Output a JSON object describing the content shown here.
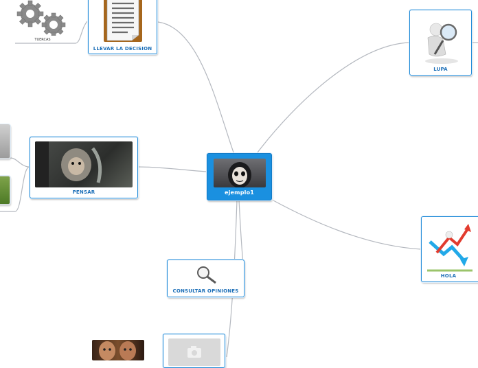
{
  "central": {
    "label": "ejemplo1"
  },
  "nodes": {
    "llevar": {
      "label": "LLEVAR LA DECISION"
    },
    "tuercas": {
      "label": "TUERCAS"
    },
    "lupa": {
      "label": "LUPA"
    },
    "pensar": {
      "label": "PENSAR"
    },
    "hola": {
      "label": "HOLA"
    },
    "consultar": {
      "label": "CONSULTAR OPINIONES"
    }
  },
  "icons": {
    "central_image": "dark-face-photo",
    "llevar_image": "clipboard-icon",
    "tuercas_image": "gears-icon",
    "lupa_image": "magnifier-figure-icon",
    "pensar_image": "monkey-photo",
    "hola_image": "growth-arrow-icon",
    "consultar_image": "magnifier-icon",
    "bottom_image": "camera-placeholder-icon"
  },
  "colors": {
    "accent": "#1a90e0",
    "border": "#1f8ad8",
    "label": "#1c6fb8",
    "connector": "#b4b8bf"
  }
}
